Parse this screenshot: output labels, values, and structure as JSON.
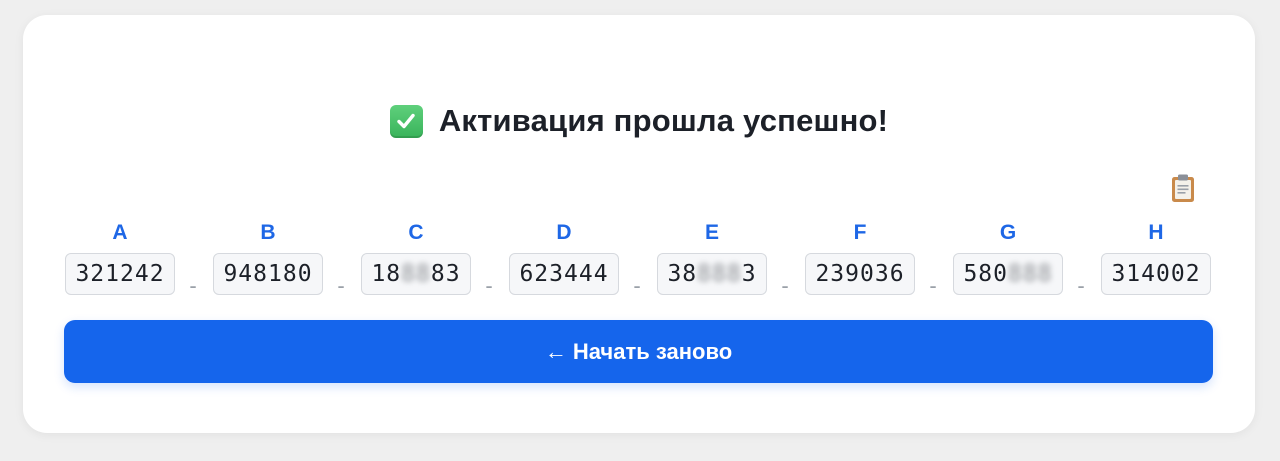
{
  "header": {
    "icon": "check-mark-button-icon",
    "title": "Активация прошла успешно!"
  },
  "copy": {
    "icon": "clipboard-icon"
  },
  "codes": [
    {
      "letter": "A",
      "visible": "321242",
      "hidden": "",
      "tail": ""
    },
    {
      "letter": "B",
      "visible": "948180",
      "hidden": "",
      "tail": ""
    },
    {
      "letter": "C",
      "visible": "18",
      "hidden": "88",
      "tail": "83"
    },
    {
      "letter": "D",
      "visible": "623444",
      "hidden": "",
      "tail": ""
    },
    {
      "letter": "E",
      "visible": "38",
      "hidden": "888",
      "tail": "3"
    },
    {
      "letter": "F",
      "visible": "239036",
      "hidden": "",
      "tail": ""
    },
    {
      "letter": "G",
      "visible": "580",
      "hidden": "888",
      "tail": ""
    },
    {
      "letter": "H",
      "visible": "314002",
      "hidden": "",
      "tail": ""
    }
  ],
  "separator": "-",
  "restart_button": {
    "arrow": "←",
    "label": "Начать заново"
  },
  "colors": {
    "accent": "#1565ec",
    "letter": "#1e67e6",
    "success": "#39b35a"
  }
}
